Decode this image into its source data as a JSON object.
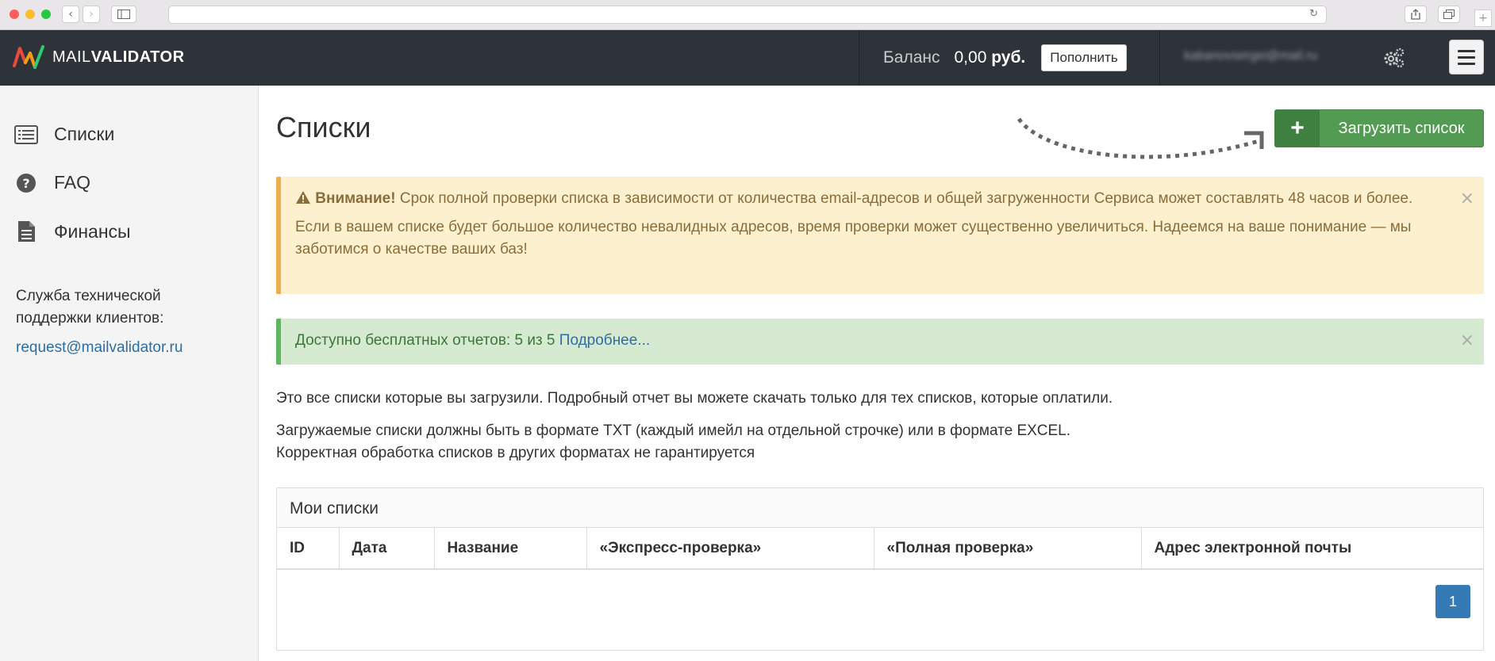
{
  "browser": {
    "back_label": "‹",
    "forward_label": "›"
  },
  "header": {
    "logo_text_light": "MAIL",
    "logo_text_bold": "VALIDATOR",
    "balance_label": "Баланс",
    "balance_amount": "0,00",
    "balance_currency": "руб.",
    "topup_label": "Пополнить",
    "user_email": "kabanovsergei@mail.ru"
  },
  "sidebar": {
    "items": [
      {
        "label": "Списки",
        "icon": "list-icon"
      },
      {
        "label": "FAQ",
        "icon": "question-circle-icon"
      },
      {
        "label": "Финансы",
        "icon": "document-icon"
      }
    ],
    "support_text": "Служба технической поддержки клиентов:",
    "support_email": "request@mailvalidator.ru"
  },
  "main": {
    "title": "Списки",
    "upload_label": "Загрузить список",
    "warning": {
      "strong": "Внимание!",
      "text1": " Срок полной проверки списка в зависимости от количества email-адресов и общей загруженности Сервиса может составлять 48 часов и более.",
      "text2": "Если в вашем списке будет большое количество невалидных адресов, время проверки может существенно увеличиться. Надеемся на ваше понимание — мы заботимся о качестве ваших баз!"
    },
    "free_reports": {
      "text": "Доступно бесплатных отчетов: 5 из 5 ",
      "link": "Подробнее..."
    },
    "info1": "Это все списки которые вы загрузили. Подробный отчет вы можете скачать только для тех списков, которые оплатили.",
    "info2": "Загружаемые списки должны быть в формате TXT (каждый имейл на отдельной строчке) или в формате EXCEL.",
    "info3": "Корректная обработка списков в других форматах не гарантируется",
    "table": {
      "heading": "Мои списки",
      "columns": [
        "ID",
        "Дата",
        "Название",
        "«Экспресс-проверка»",
        "«Полная проверка»",
        "Адрес электронной почты"
      ]
    },
    "pagination_current": "1"
  },
  "colors": {
    "topbar": "#2d3339",
    "upload_button": "#539a53",
    "warning_bg": "#fcf0ce",
    "success_bg": "#d5ead0",
    "link": "#2e6da4",
    "pagination": "#337ab7"
  }
}
